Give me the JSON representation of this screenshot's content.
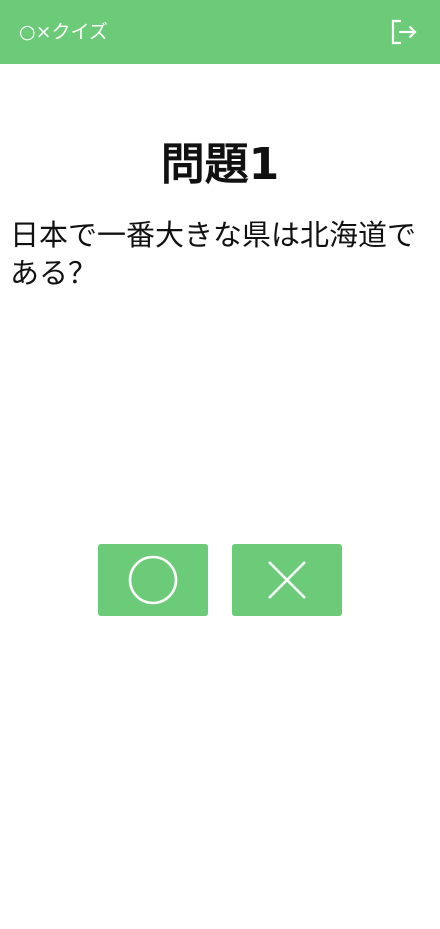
{
  "colors": {
    "accent": "#6ccb78",
    "text": "#111111",
    "on_accent": "#ffffff"
  },
  "header": {
    "title": "○×クイズ",
    "logout_icon": "logout-icon"
  },
  "question": {
    "title": "問題1",
    "text": "日本で一番大きな県は北海道である？"
  },
  "answers": {
    "true_icon": "circle-icon",
    "false_icon": "cross-icon"
  }
}
